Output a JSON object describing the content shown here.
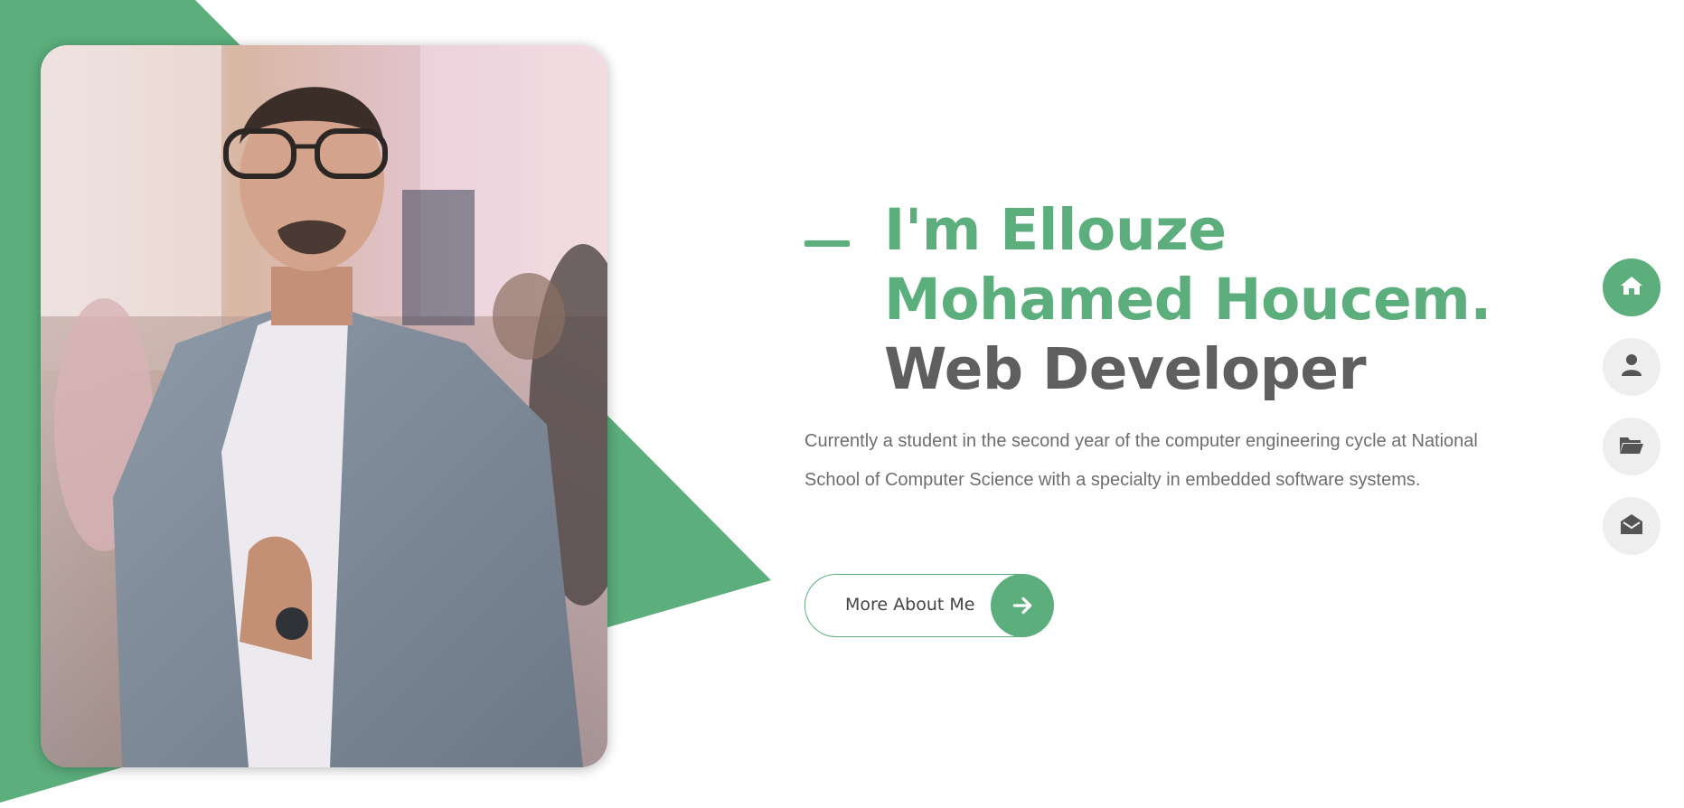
{
  "hero": {
    "title_line1": "I'm Ellouze",
    "title_line2": "Mohamed Houcem.",
    "title_line3": "Web Developer",
    "description": "Currently a student in the second year of the computer engineering cycle at National School of Computer Science with a specialty in embedded software systems.",
    "cta_label": "More About Me",
    "cta_icon": "arrow-right-icon"
  },
  "side_nav": {
    "items": [
      {
        "icon": "home-icon",
        "active": true
      },
      {
        "icon": "user-icon",
        "active": false
      },
      {
        "icon": "folder-open-icon",
        "active": false
      },
      {
        "icon": "envelope-open-icon",
        "active": false
      }
    ]
  },
  "colors": {
    "accent": "#5cae7c",
    "heading_grey": "#5f5f5f",
    "text_grey": "#6e6e6e",
    "nav_bg": "#eeeeee"
  }
}
